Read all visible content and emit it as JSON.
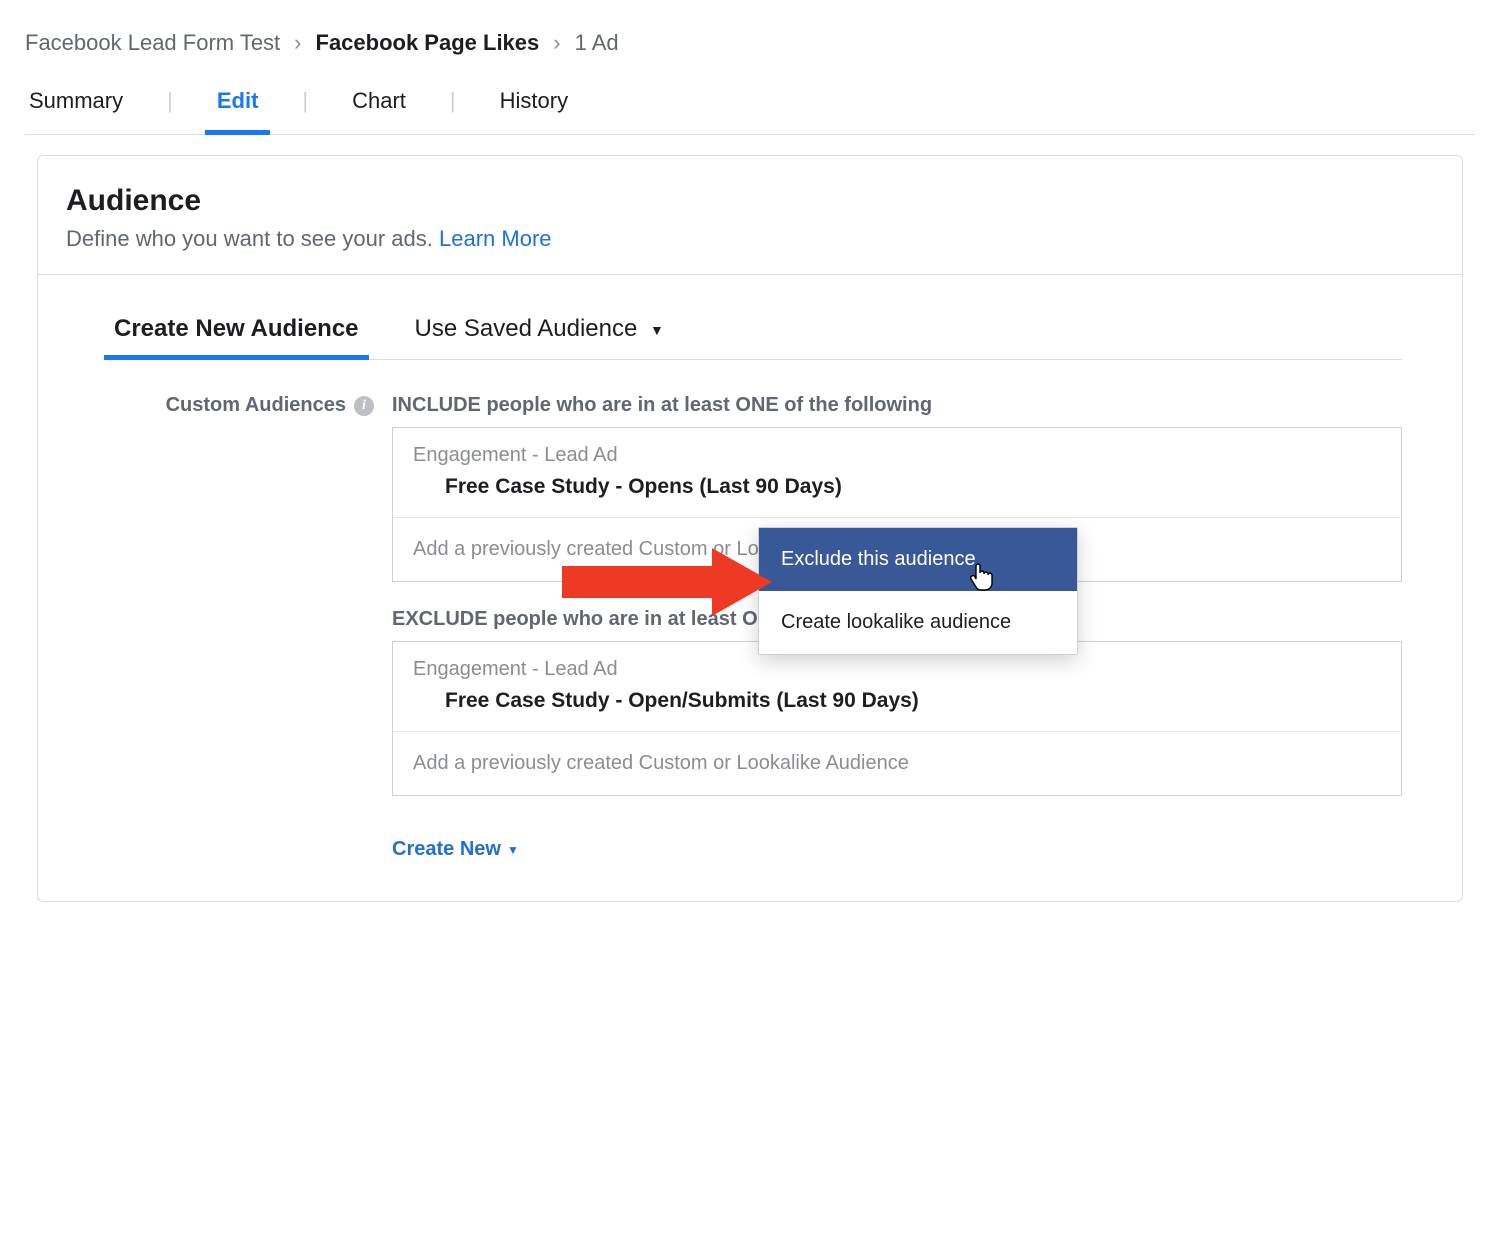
{
  "breadcrumb": {
    "level1": "Facebook Lead Form Test",
    "level2": "Facebook Page Likes",
    "level3": "1 Ad"
  },
  "tabs": {
    "summary": "Summary",
    "edit": "Edit",
    "chart": "Chart",
    "history": "History"
  },
  "panel": {
    "title": "Audience",
    "subtitle": "Define who you want to see your ads.",
    "learn_more": "Learn More"
  },
  "audience_tabs": {
    "create": "Create New Audience",
    "saved": "Use Saved Audience"
  },
  "side_label": "Custom Audiences",
  "include": {
    "title": "INCLUDE people who are in at least ONE of the following",
    "category": "Engagement - Lead Ad",
    "name": "Free Case Study - Opens (Last 90 Days)",
    "placeholder": "Add a previously created Custom or Lookalike Audience"
  },
  "exclude": {
    "title": "EXCLUDE people who are in at least ONE of the following",
    "category": "Engagement - Lead Ad",
    "name": "Free Case Study - Open/Submits (Last 90 Days)",
    "placeholder": "Add a previously created Custom or Lookalike Audience"
  },
  "menu": {
    "exclude": "Exclude this audience",
    "lookalike": "Create lookalike audience"
  },
  "create_new": "Create New"
}
